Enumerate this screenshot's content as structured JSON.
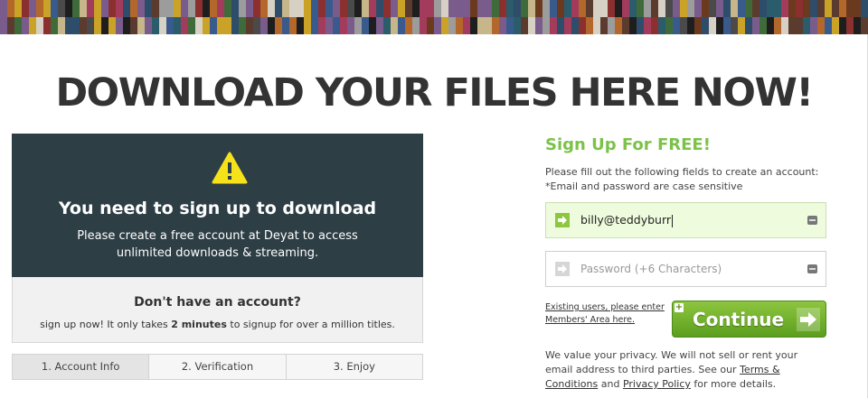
{
  "banner": {
    "colors": [
      "#5a3b2e",
      "#c9a227",
      "#2e4d6b",
      "#8c2f2f",
      "#3f6b3a",
      "#d6d1c4",
      "#1e1e1e",
      "#7a5c8c",
      "#b3672b",
      "#4a4a4a",
      "#a33b5c",
      "#2b5c6b",
      "#c7b68a",
      "#6b3a1e",
      "#385a8c",
      "#9c9c9c"
    ]
  },
  "headline": "DOWNLOAD YOUR FILES HERE NOW!",
  "notice": {
    "title": "You need to sign up to download",
    "text_line1": "Please create a free account at Deyat to access",
    "text_line2": "unlimited downloads & streaming.",
    "icon": "warning-icon",
    "bg_color": "#2d3e45"
  },
  "no_account": {
    "title": "Don't have an account?",
    "text_before": "sign up now! It only takes ",
    "text_bold": "2 minutes",
    "text_after": " to signup for over a million titles."
  },
  "steps": [
    "1. Account Info",
    "2. Verification",
    "3. Enjoy"
  ],
  "signup": {
    "title": "Sign Up For FREE!",
    "desc_line1": "Please fill out the following fields to create an account:",
    "desc_line2": "*Email and password are case sensitive",
    "email_value": "billy@teddyburr",
    "password_placeholder": "Password (+6 Characters)",
    "existing_line1": "Existing users, please enter",
    "existing_line2": "Members' Area here.",
    "continue_label": "Continue",
    "accent_color": "#7cc24a"
  },
  "privacy": {
    "text_before": "We value your privacy. We will not sell or rent your email address to third parties. See our ",
    "terms_link": "Terms & Conditions",
    "text_mid": " and ",
    "privacy_link": "Privacy Policy",
    "text_after": " for more details."
  }
}
